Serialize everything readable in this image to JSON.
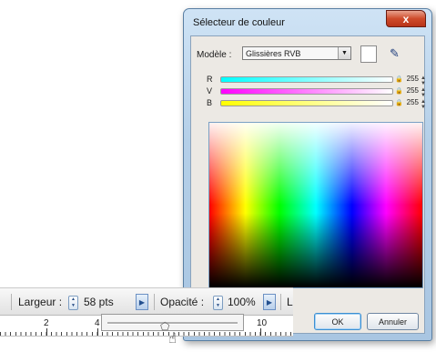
{
  "dialog": {
    "title": "Sélecteur de couleur",
    "close_glyph": "x",
    "model_label": "Modèle :",
    "model_value": "Glissières RVB",
    "swatch_color": "#ffffff",
    "channels": [
      {
        "label": "R",
        "value": "255",
        "gradient": "linear-gradient(to right, #00ffff, #ffffff)"
      },
      {
        "label": "V",
        "value": "255",
        "gradient": "linear-gradient(to right, #ff00ff, #ffffff)"
      },
      {
        "label": "B",
        "value": "255",
        "gradient": "linear-gradient(to right, #ffff00, #ffffff)"
      }
    ],
    "ok_label": "OK",
    "cancel_label": "Annuler"
  },
  "toolbar": {
    "width_label": "Largeur :",
    "width_value": "58 pts",
    "opacity_label": "Opacité :",
    "opacity_value": "100%",
    "trailing_label": "L"
  },
  "ruler": {
    "labels": [
      "2",
      "4",
      "10"
    ]
  }
}
